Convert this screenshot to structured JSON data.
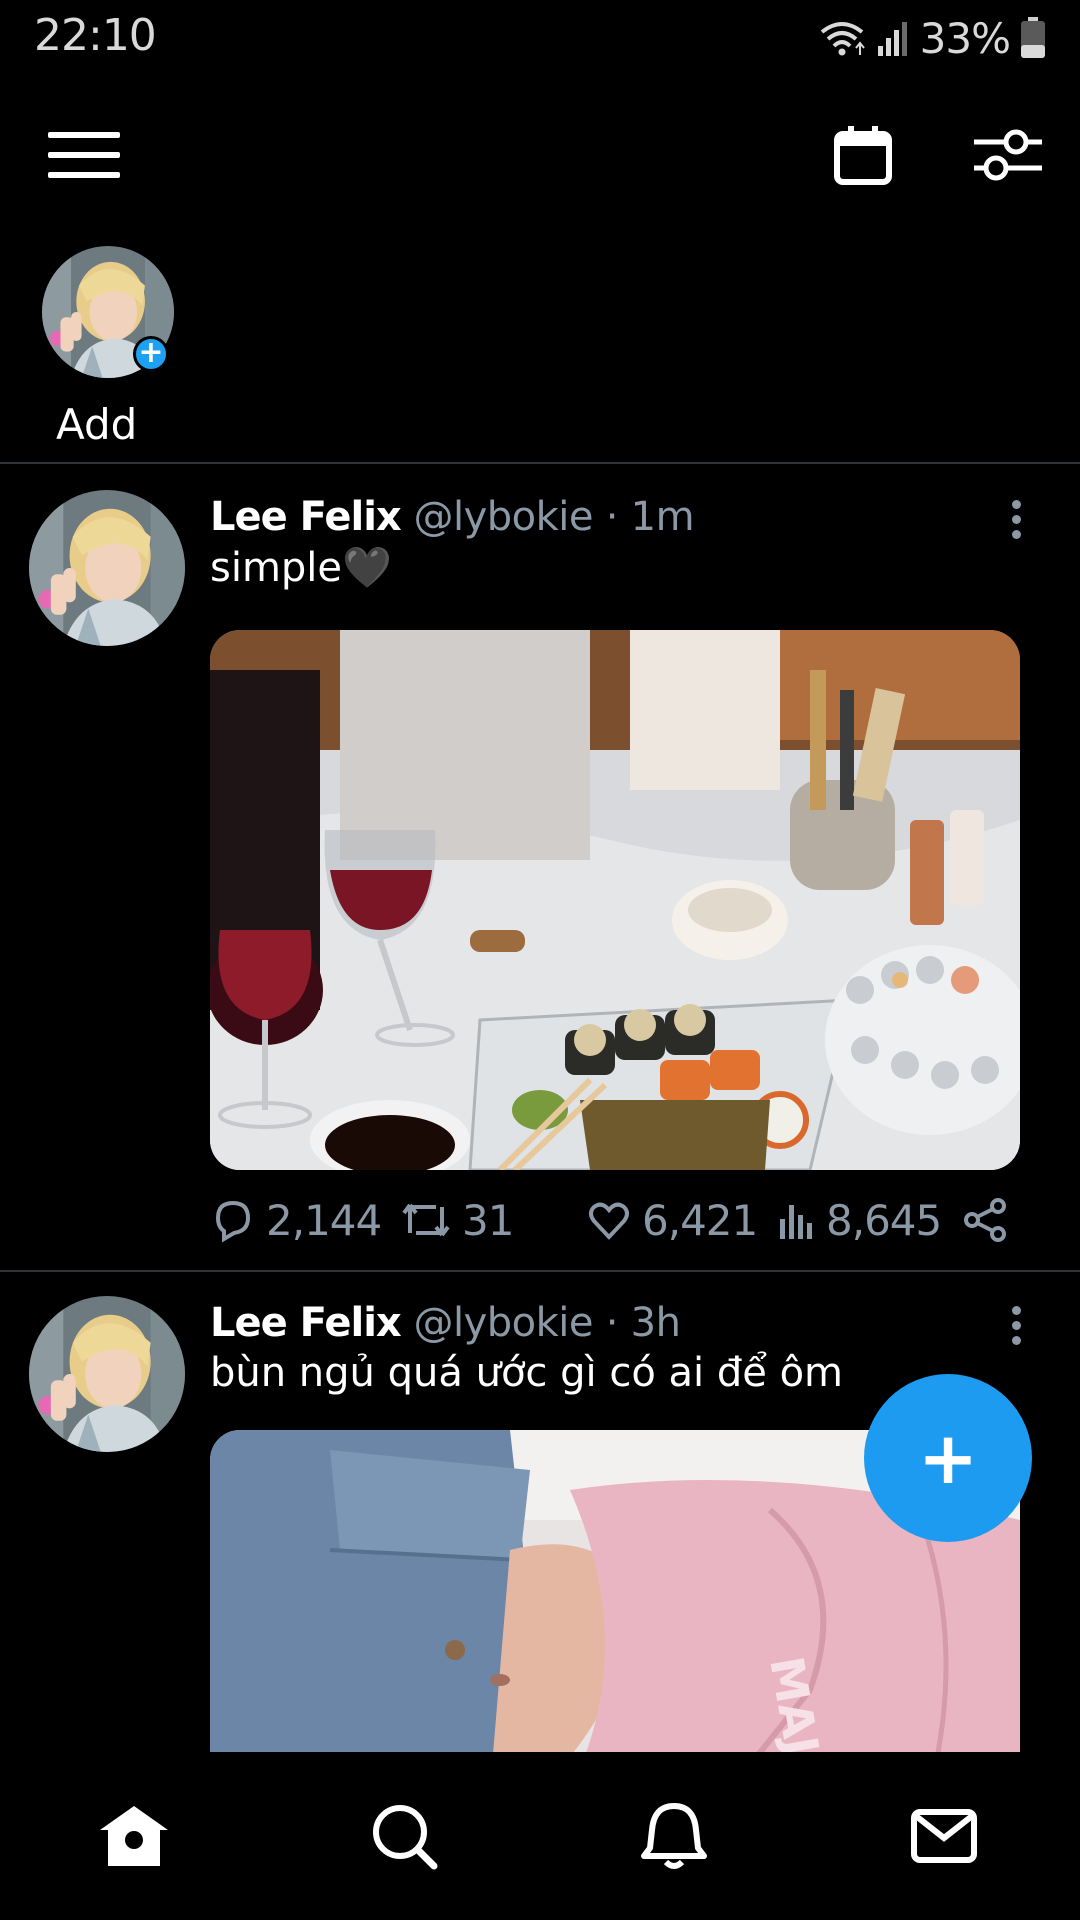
{
  "status_bar": {
    "time": "22:10",
    "battery_text": "33%",
    "icons": [
      "wifi-icon",
      "signal-icon",
      "battery-icon"
    ]
  },
  "top_bar": {
    "icons": [
      "hamburger-menu-icon",
      "calendar-icon",
      "sliders-icon"
    ]
  },
  "fleets": {
    "add_label": "Add"
  },
  "tweets": [
    {
      "name": "Lee Felix",
      "handle": "@lybokie",
      "separator": "·",
      "time": "1m",
      "text": "simple🖤",
      "reply_count": "2,144",
      "retweet_count": "31",
      "like_count": "6,421",
      "view_count": "8,645"
    },
    {
      "name": "Lee Felix",
      "handle": "@lybokie",
      "separator": "·",
      "time": "3h",
      "text": "bùn ngủ quá ước gì có ai để ôm"
    }
  ],
  "fab": {
    "label": "+"
  },
  "bottom_nav": {
    "items": [
      "home-icon",
      "search-icon",
      "notifications-icon",
      "messages-icon"
    ]
  },
  "colors": {
    "accent": "#1d9bf0",
    "background": "#000000",
    "secondary_text": "#8b98a5",
    "divider": "#2f3336"
  }
}
